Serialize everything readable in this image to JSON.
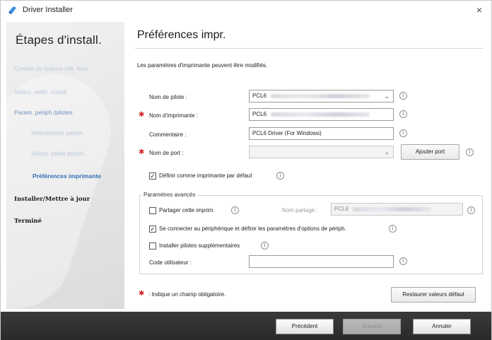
{
  "window": {
    "title": "Driver Installer",
    "close_glyph": "×",
    "app_icon": "driver-installer-icon"
  },
  "sidebar": {
    "title": "Étapes d'install.",
    "items": [
      {
        "label": "Contrat de licence utili. final",
        "state": "done"
      },
      {
        "label": "Sélect. méth. install.",
        "state": "done"
      },
      {
        "label": "Param. périph./pilotes",
        "state": "group"
      },
      {
        "label": "Sélectionner périph.",
        "state": "done-sub"
      },
      {
        "label": "Sélect. pilote périph.",
        "state": "done-sub"
      },
      {
        "label": "Préférences imprimante",
        "state": "active"
      },
      {
        "label": "Installer/Mettre à jour",
        "state": "pending"
      },
      {
        "label": "Terminé",
        "state": "pending"
      }
    ]
  },
  "main": {
    "title": "Préférences impr.",
    "intro": "Les paramètres d'imprimante peuvent être modifiés.",
    "driver_name": {
      "label": "Nom de pilote :",
      "value": "PCL6",
      "control": "dropdown"
    },
    "printer_name": {
      "label": "Nom d'imprimante :",
      "value": "PCL6",
      "required": true
    },
    "comment": {
      "label": "Commentaire :",
      "value": "PCL6 Driver (For Windows)"
    },
    "port_name": {
      "label": "Nom de port :",
      "value": "",
      "required": true,
      "control": "dropdown"
    },
    "add_port_button": "Ajouter port",
    "default_printer": {
      "label": "Définir comme imprimante par défaut",
      "checked": true
    },
    "advanced": {
      "legend": "Paramètres avancés",
      "share": {
        "label": "Partager cette imprim.",
        "checked": false
      },
      "share_name": {
        "label": "Nom partagé :",
        "value": "PCL6"
      },
      "connect": {
        "label": "Se connecter au périphérique et définir les paramètres d'options de périph.",
        "checked": true
      },
      "extra_drivers": {
        "label": "Installer pilotes supplémentaires",
        "checked": false
      },
      "user_code": {
        "label": "Code utilisateur :",
        "value": ""
      }
    },
    "required_note": ": Indique un champ obligatoire.",
    "restore_button": "Restaurer valeurs défaut"
  },
  "footer": {
    "back_button": "Précédent",
    "next_button": "Suivant",
    "cancel_button": "Annuler"
  },
  "glyphs": {
    "required_mark": "✱",
    "info": "i",
    "chevron": "⌄",
    "check": "✓"
  },
  "colors": {
    "required": "#d0272b",
    "active_step": "#2f6fb3",
    "footer_bg": "#2f2f2f"
  }
}
